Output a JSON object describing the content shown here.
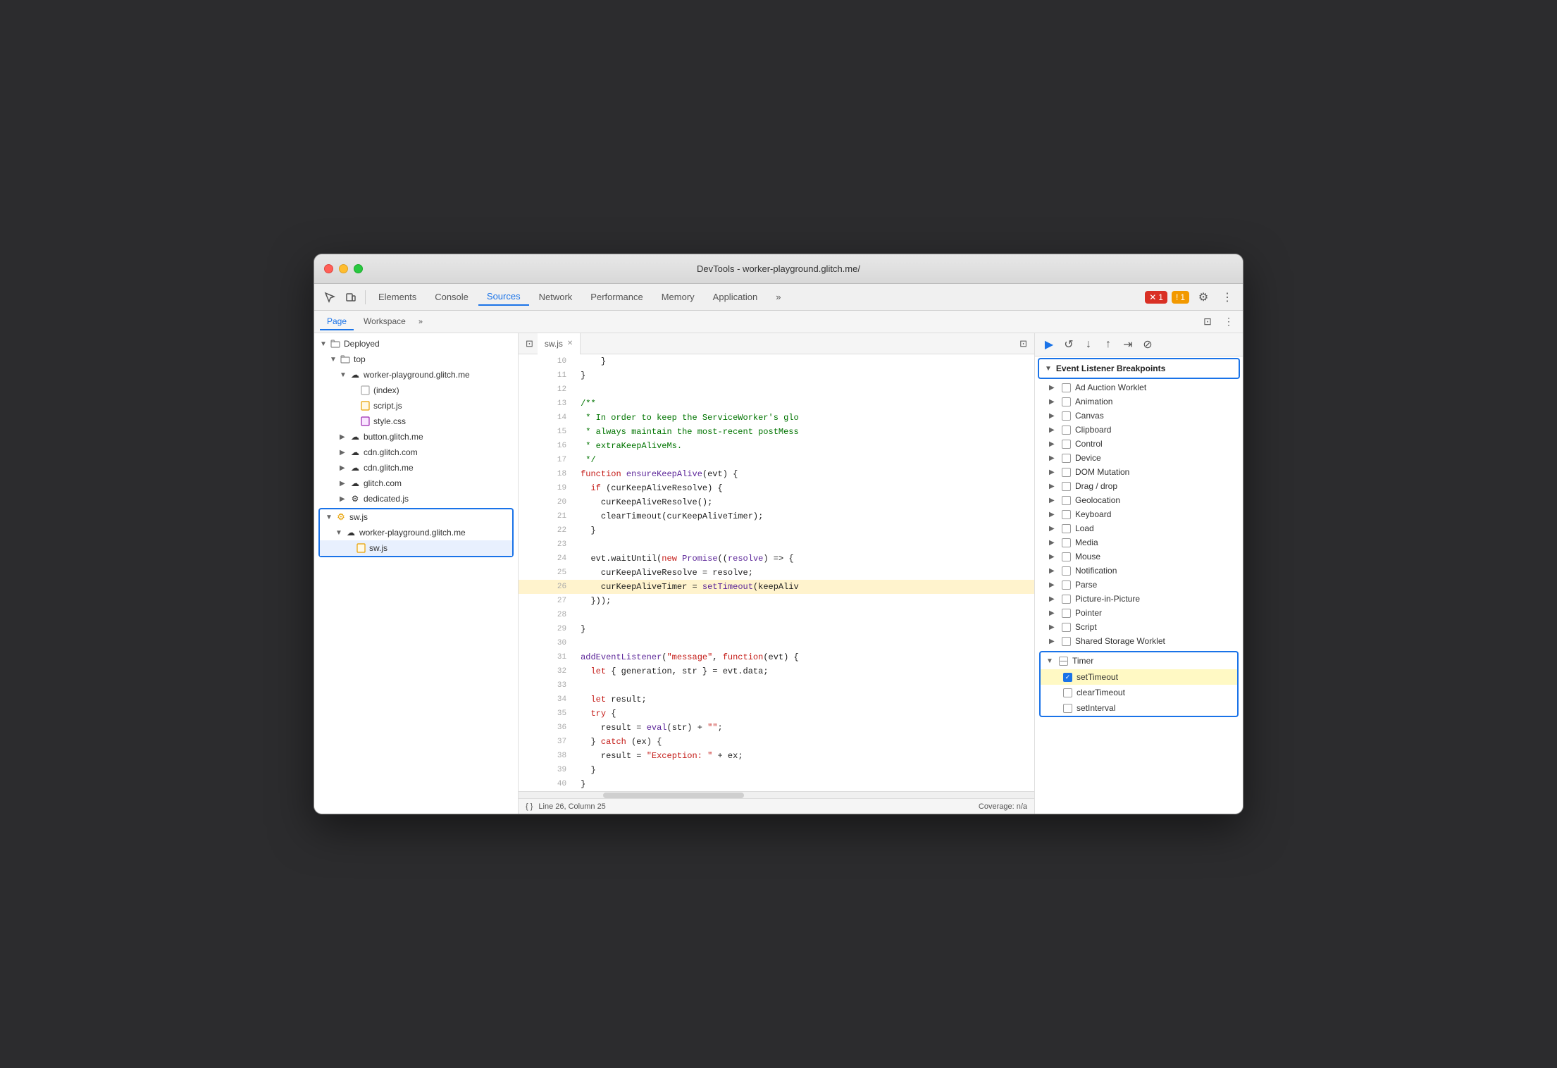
{
  "window": {
    "title": "DevTools - worker-playground.glitch.me/"
  },
  "toolbar": {
    "tabs": [
      "Elements",
      "Console",
      "Sources",
      "Network",
      "Performance",
      "Memory",
      "Application"
    ],
    "active_tab": "Sources",
    "more_label": "»",
    "error_count": "1",
    "warn_count": "1"
  },
  "secondary_toolbar": {
    "tabs": [
      "Page",
      "Workspace"
    ],
    "more_label": "»",
    "active_tab": "Page"
  },
  "file_tree": {
    "items": [
      {
        "id": "deployed",
        "label": "Deployed",
        "indent": 0,
        "type": "folder",
        "expanded": true
      },
      {
        "id": "top",
        "label": "top",
        "indent": 1,
        "type": "folder",
        "expanded": true
      },
      {
        "id": "worker-playground",
        "label": "worker-playground.glitch.me",
        "indent": 2,
        "type": "cloud",
        "expanded": true
      },
      {
        "id": "index",
        "label": "(index)",
        "indent": 3,
        "type": "file-white"
      },
      {
        "id": "script-js",
        "label": "script.js",
        "indent": 3,
        "type": "file-orange"
      },
      {
        "id": "style-css",
        "label": "style.css",
        "indent": 3,
        "type": "file-purple"
      },
      {
        "id": "button-glitch",
        "label": "button.glitch.me",
        "indent": 2,
        "type": "cloud"
      },
      {
        "id": "cdn-glitch-com",
        "label": "cdn.glitch.com",
        "indent": 2,
        "type": "cloud"
      },
      {
        "id": "cdn-glitch-me",
        "label": "cdn.glitch.me",
        "indent": 2,
        "type": "cloud"
      },
      {
        "id": "glitch-com",
        "label": "glitch.com",
        "indent": 2,
        "type": "cloud"
      },
      {
        "id": "dedicated-js",
        "label": "dedicated.js",
        "indent": 2,
        "type": "gear-file"
      }
    ],
    "blue_box_items": [
      {
        "id": "sw-js-top",
        "label": "sw.js",
        "indent": 0,
        "type": "gear-file",
        "expanded": true
      },
      {
        "id": "worker-playground-2",
        "label": "worker-playground.glitch.me",
        "indent": 1,
        "type": "cloud",
        "expanded": true
      },
      {
        "id": "sw-js-file",
        "label": "sw.js",
        "indent": 2,
        "type": "file-orange"
      }
    ]
  },
  "editor": {
    "tab_label": "sw.js",
    "lines": [
      {
        "num": 10,
        "content": "    }"
      },
      {
        "num": 11,
        "content": "}"
      },
      {
        "num": 12,
        "content": ""
      },
      {
        "num": 13,
        "content": "/**",
        "type": "comment"
      },
      {
        "num": 14,
        "content": " * In order to keep the ServiceWorker's glo",
        "type": "comment"
      },
      {
        "num": 15,
        "content": " * always maintain the most-recent postMess",
        "type": "comment"
      },
      {
        "num": 16,
        "content": " * extraKeepAliveMs.",
        "type": "comment"
      },
      {
        "num": 17,
        "content": " */",
        "type": "comment"
      },
      {
        "num": 18,
        "content": "function ensureKeepAlive(evt) {",
        "type": "function"
      },
      {
        "num": 19,
        "content": "  if (curKeepAliveResolve) {",
        "type": "if"
      },
      {
        "num": 20,
        "content": "    curKeepAliveResolve();",
        "type": "call"
      },
      {
        "num": 21,
        "content": "    clearTimeout(curKeepAliveTimer);",
        "type": "call"
      },
      {
        "num": 22,
        "content": "  }",
        "type": "normal"
      },
      {
        "num": 23,
        "content": "",
        "type": "normal"
      },
      {
        "num": 24,
        "content": "  evt.waitUntil(new Promise((resolve) => {",
        "type": "code"
      },
      {
        "num": 25,
        "content": "    curKeepAliveResolve = resolve;",
        "type": "code"
      },
      {
        "num": 26,
        "content": "    curKeepAliveTimer = setTimeout(keepAliv",
        "type": "highlighted"
      },
      {
        "num": 27,
        "content": "  }));",
        "type": "normal"
      },
      {
        "num": 28,
        "content": "",
        "type": "normal"
      },
      {
        "num": 29,
        "content": "}",
        "type": "normal"
      },
      {
        "num": 30,
        "content": "",
        "type": "normal"
      },
      {
        "num": 31,
        "content": "addEventListener(\"message\", function(evt) {",
        "type": "code"
      },
      {
        "num": 32,
        "content": "  let { generation, str } = evt.data;",
        "type": "code"
      },
      {
        "num": 33,
        "content": "",
        "type": "normal"
      },
      {
        "num": 34,
        "content": "  let result;",
        "type": "code"
      },
      {
        "num": 35,
        "content": "  try {",
        "type": "code"
      },
      {
        "num": 36,
        "content": "    result = eval(str) + \"\";",
        "type": "code"
      },
      {
        "num": 37,
        "content": "  } catch (ex) {",
        "type": "code"
      },
      {
        "num": 38,
        "content": "    result = \"Exception: \" + ex;",
        "type": "code"
      },
      {
        "num": 39,
        "content": "  }",
        "type": "normal"
      },
      {
        "num": 40,
        "content": "}",
        "type": "normal"
      }
    ],
    "status": {
      "format": "{ }",
      "position": "Line 26, Column 25",
      "coverage": "Coverage: n/a"
    }
  },
  "right_panel": {
    "section_title": "Event Listener Breakpoints",
    "items": [
      {
        "label": "Ad Auction Worklet",
        "checked": false,
        "expandable": true
      },
      {
        "label": "Animation",
        "checked": false,
        "expandable": true
      },
      {
        "label": "Canvas",
        "checked": false,
        "expandable": true
      },
      {
        "label": "Clipboard",
        "checked": false,
        "expandable": true
      },
      {
        "label": "Control",
        "checked": false,
        "expandable": true
      },
      {
        "label": "Device",
        "checked": false,
        "expandable": true
      },
      {
        "label": "DOM Mutation",
        "checked": false,
        "expandable": true
      },
      {
        "label": "Drag / drop",
        "checked": false,
        "expandable": true
      },
      {
        "label": "Geolocation",
        "checked": false,
        "expandable": true
      },
      {
        "label": "Keyboard",
        "checked": false,
        "expandable": true
      },
      {
        "label": "Load",
        "checked": false,
        "expandable": true
      },
      {
        "label": "Media",
        "checked": false,
        "expandable": true
      },
      {
        "label": "Mouse",
        "checked": false,
        "expandable": true
      },
      {
        "label": "Notification",
        "checked": false,
        "expandable": true
      },
      {
        "label": "Parse",
        "checked": false,
        "expandable": true
      },
      {
        "label": "Picture-in-Picture",
        "checked": false,
        "expandable": true
      },
      {
        "label": "Pointer",
        "checked": false,
        "expandable": true
      },
      {
        "label": "Script",
        "checked": false,
        "expandable": true
      },
      {
        "label": "Shared Storage Worklet",
        "checked": false,
        "expandable": true
      }
    ],
    "timer_section": {
      "label": "Timer",
      "expanded": true,
      "items": [
        {
          "label": "setTimeout",
          "checked": true
        },
        {
          "label": "clearTimeout",
          "checked": false
        },
        {
          "label": "setInterval",
          "checked": false
        }
      ]
    }
  }
}
